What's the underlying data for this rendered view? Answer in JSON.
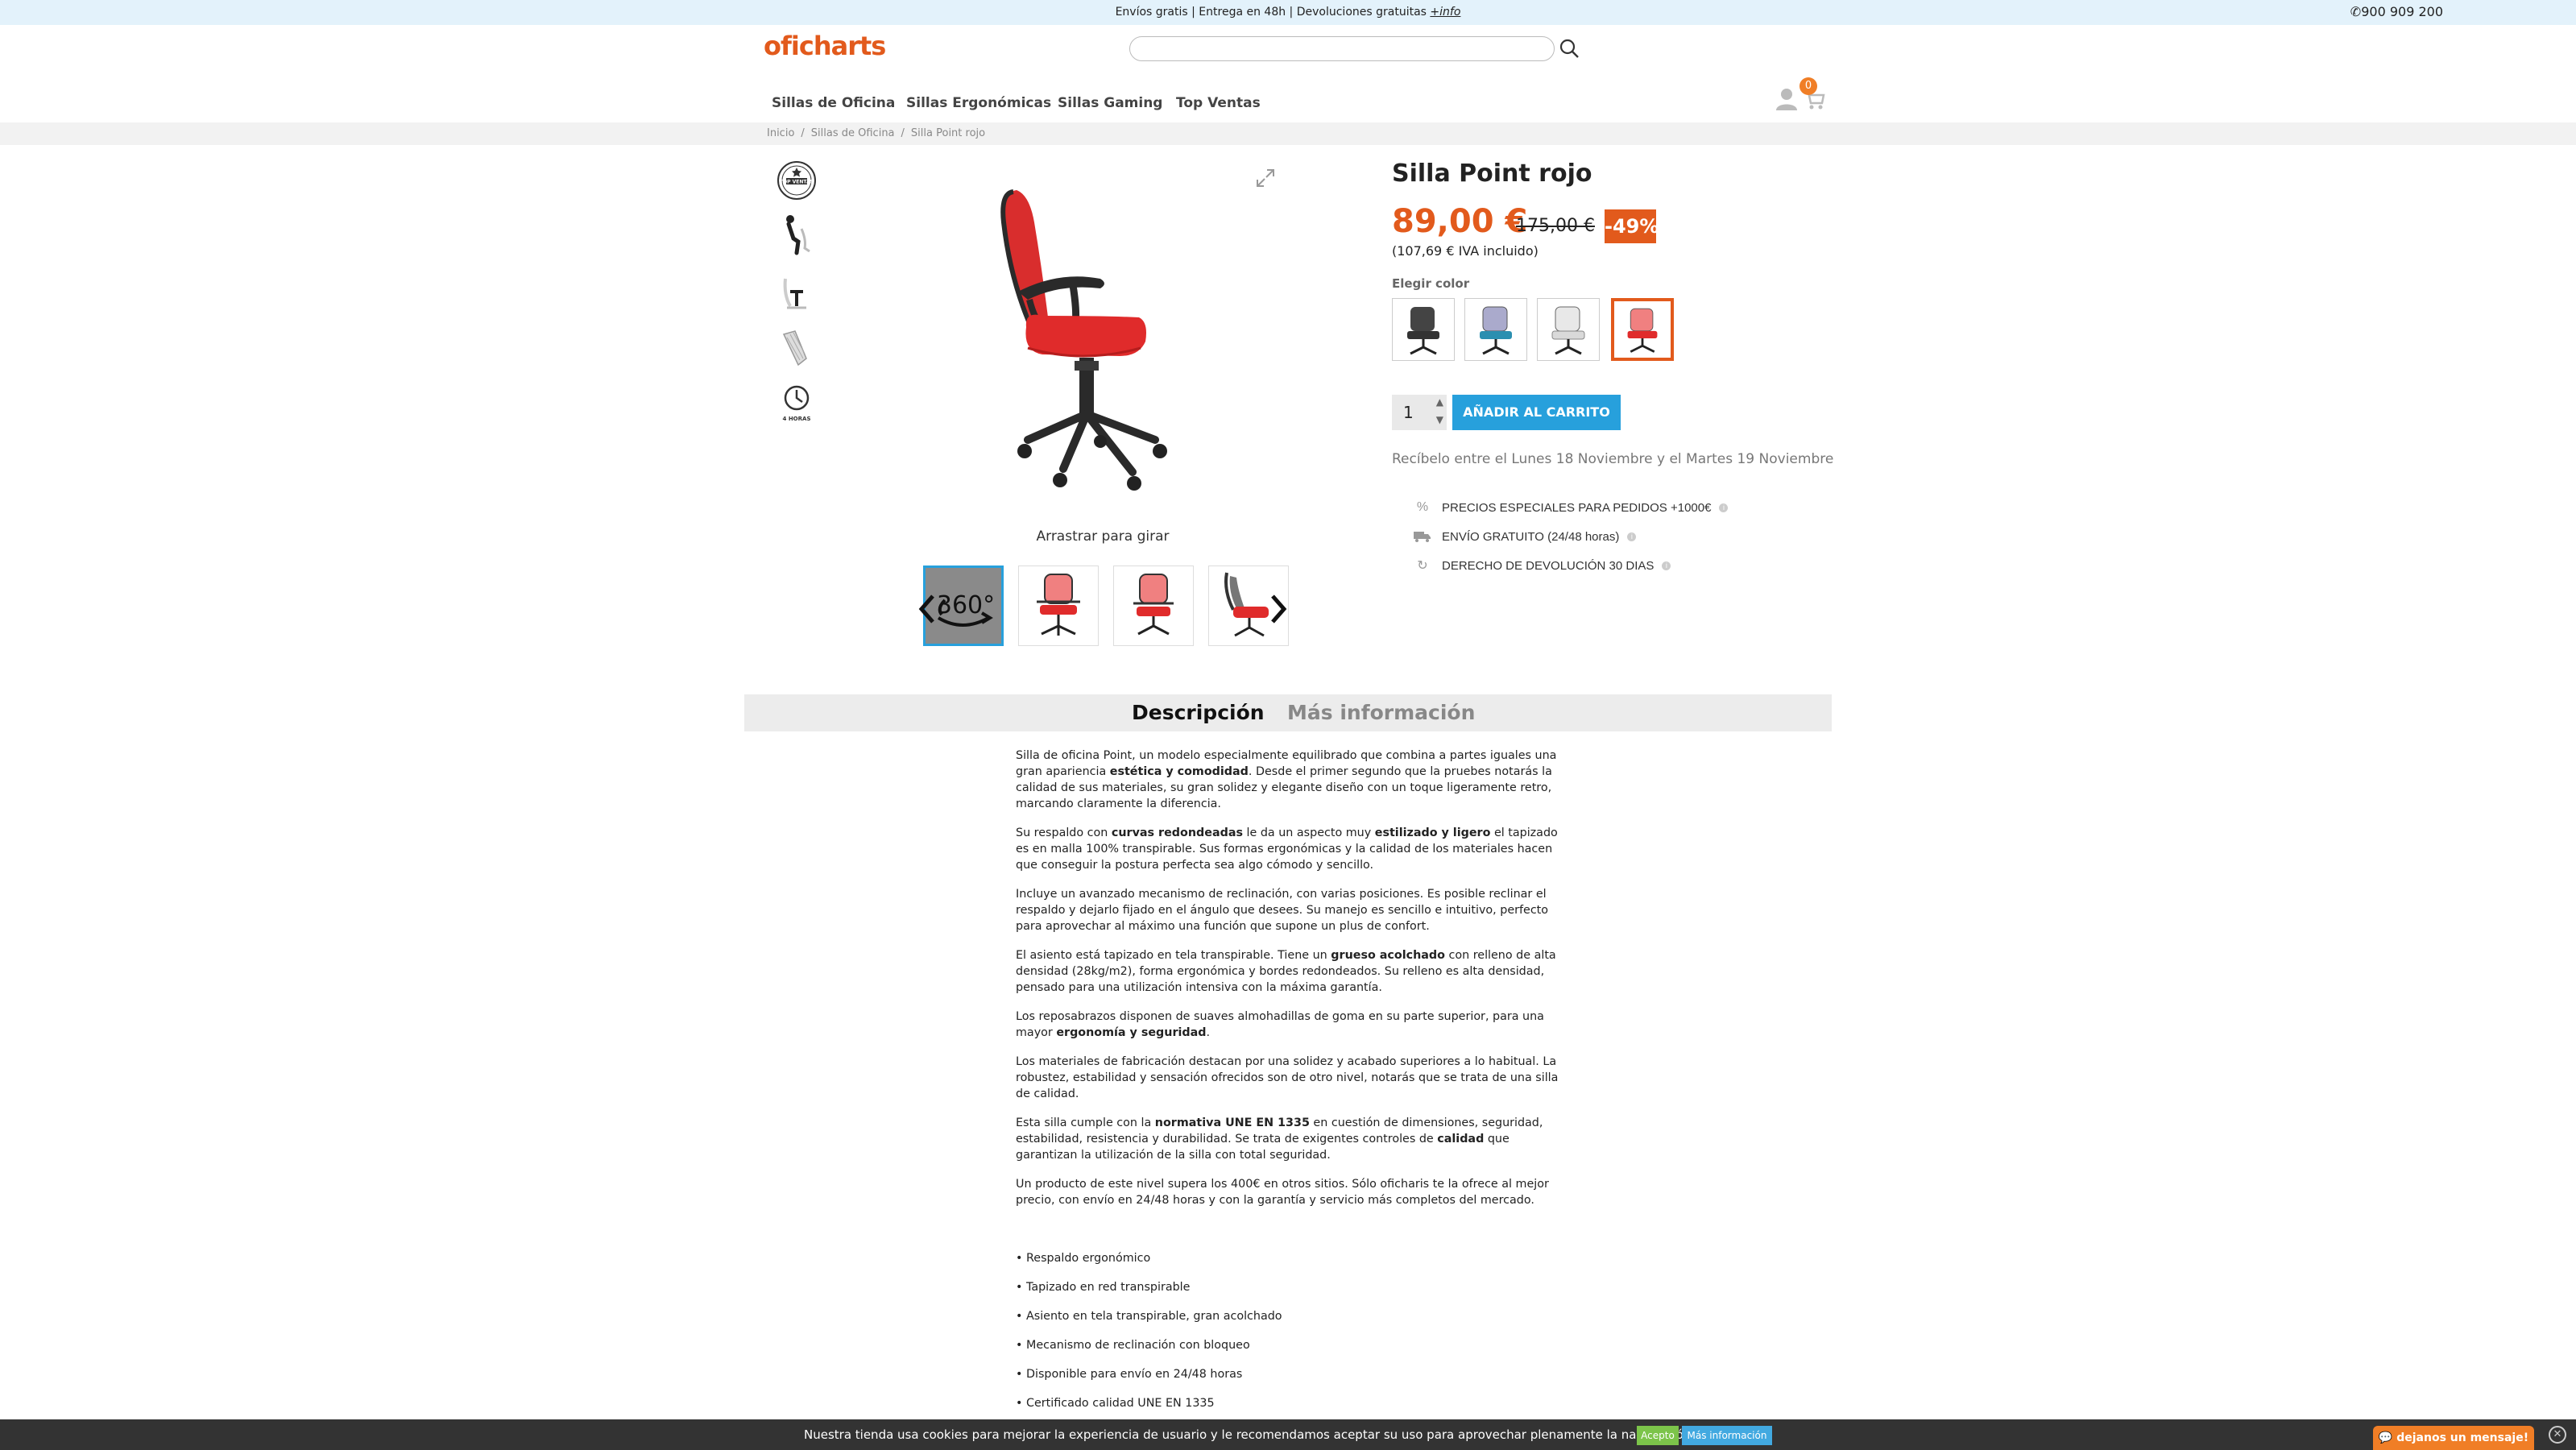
{
  "topbar": {
    "shipping_text": "Envíos gratis | Entrega en 48h | Devoluciones gratuitas",
    "info_link": "+info",
    "phone": "900 909 200"
  },
  "header": {
    "logo": "oficharts",
    "search_placeholder": "",
    "cart_count": "0"
  },
  "nav": {
    "items": [
      "Sillas de Oficina",
      "Sillas Ergonómicas",
      "Sillas Gaming",
      "Top Ventas"
    ]
  },
  "breadcrumb": {
    "items": [
      "Inicio",
      "Sillas de Oficina",
      "Silla Point rojo"
    ],
    "separator": "/"
  },
  "features": {
    "icons": [
      "top-ventas-badge-icon",
      "ergonomic-posture-icon",
      "armrest-t-icon",
      "mesh-backrest-icon",
      "4-horas-clock-icon"
    ],
    "top_ventas_text": "TOP VENTAS",
    "hours_text": "4 HORAS"
  },
  "gallery": {
    "drag_label": "Arrastrar para girar",
    "badge_360": "360°"
  },
  "product": {
    "title": "Silla Point rojo",
    "price": "89,00 €",
    "old_price": "175,00 €",
    "discount": "-49%",
    "iva_note": "(107,69 € IVA incluido)",
    "color_label": "Elegir color",
    "colors": [
      "#444444",
      "#2b8fb0",
      "#d9d9d9",
      "#e02b2b"
    ],
    "selected_color_index": 3,
    "quantity": "1",
    "add_to_cart": "AÑADIR AL CARRITO",
    "delivery_text": "Recíbelo entre el Lunes 18 Noviembre y el Martes 19 Noviembre"
  },
  "benefits": [
    {
      "icon": "percent-icon",
      "label": "PRECIOS ESPECIALES PARA PEDIDOS +1000€"
    },
    {
      "icon": "truck-icon",
      "label": "ENVÍO GRATUITO (24/48 horas)"
    },
    {
      "icon": "return-arrows-icon",
      "label": "DERECHO DE DEVOLUCIÓN 30 DIAS"
    }
  ],
  "tabs": {
    "description": "Descripción",
    "more_info": "Más información"
  },
  "description": {
    "p1_a": "Silla de oficina Point, un modelo especialmente equilibrado que combina a partes iguales una gran apariencia ",
    "p1_b": "estética y comodidad",
    "p1_c": ". Desde el primer segundo que la pruebes notarás la calidad de sus materiales, su gran solidez y elegante diseño con un toque ligeramente retro, marcando claramente la diferencia.",
    "p2_a": "Su respaldo con ",
    "p2_b": "curvas redondeadas",
    "p2_c": " le da un aspecto muy ",
    "p2_d": "estilizado y ligero",
    "p2_e": " el tapizado es en malla 100% transpirable. Sus formas ergonómicas y la calidad de los materiales hacen que conseguir la postura perfecta sea algo cómodo y sencillo.",
    "p3": "Incluye un avanzado mecanismo de reclinación, con varias posiciones. Es posible reclinar el respaldo y dejarlo fijado en el ángulo que desees. Su manejo es sencillo e intuitivo, perfecto para aprovechar al máximo una función que supone un plus de confort.",
    "p4_a": "El asiento está tapizado en tela transpirable. Tiene un ",
    "p4_b": "grueso acolchado",
    "p4_c": " con relleno de alta densidad (28kg/m2), forma ergonómica y bordes redondeados. Su relleno es alta densidad, pensado para una utilización intensiva con la máxima garantía.",
    "p5_a": "Los reposabrazos disponen de suaves almohadillas de goma en su parte superior, para una mayor ",
    "p5_b": "ergonomía y seguridad",
    "p5_c": ".",
    "p6": "Los materiales de fabricación destacan por una solidez y acabado superiores a lo habitual. La robustez, estabilidad y sensación ofrecidos son de otro nivel, notarás que se trata de una silla de calidad.",
    "p7_a": "Esta silla cumple con la ",
    "p7_b": "normativa UNE EN 1335",
    "p7_c": " en cuestión de dimensiones, seguridad, estabilidad, resistencia y durabilidad. Se trata de exigentes controles de ",
    "p7_d": "calidad",
    "p7_e": " que garantizan la utilización de la silla con total seguridad.",
    "p8": "Un producto de este nivel supera los 400€ en otros sitios. Sólo oficharis te la ofrece al mejor precio, con envío en 24/48 horas y con la garantía y servicio más completos del mercado.",
    "bullets": [
      "• Respaldo ergonómico",
      "• Tapizado en red transpirable",
      "• Asiento en tela transpirable, gran acolchado",
      "• Mecanismo de reclinación con bloqueo",
      "• Disponible para envío en 24/48 horas",
      "• Certificado calidad UNE EN 1335"
    ]
  },
  "cookie": {
    "text": "Nuestra tienda usa cookies para mejorar la experiencia de usuario y le recomendamos aceptar su uso para aprovechar plenamente la navegación.",
    "accept": "Acepto",
    "more": "Más información",
    "close": "✕"
  },
  "chat": {
    "label": "dejanos un mensaje!"
  }
}
